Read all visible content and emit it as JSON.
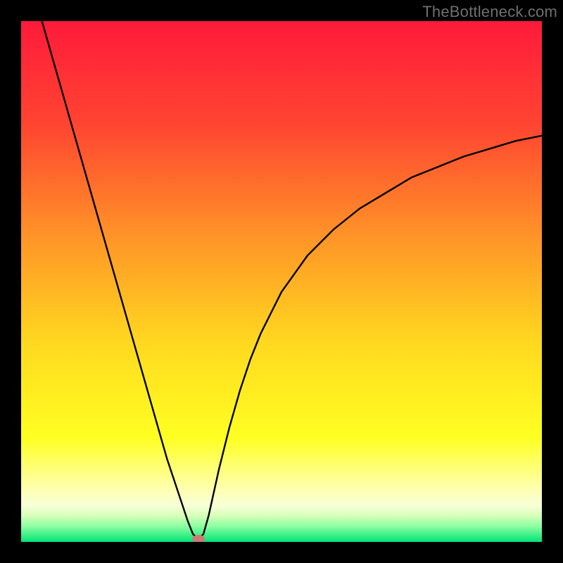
{
  "watermark": "TheBottleneck.com",
  "chart_data": {
    "type": "line",
    "title": "",
    "xlabel": "",
    "ylabel": "",
    "xlim": [
      0,
      100
    ],
    "ylim": [
      0,
      100
    ],
    "grid": false,
    "legend": false,
    "series": [
      {
        "name": "bottleneck-curve",
        "x": [
          4,
          6,
          8,
          10,
          12,
          14,
          16,
          18,
          20,
          22,
          24,
          26,
          28,
          30,
          32,
          33,
          34,
          35,
          36,
          38,
          40,
          42,
          44,
          46,
          48,
          50,
          55,
          60,
          65,
          70,
          75,
          80,
          85,
          90,
          95,
          100
        ],
        "y": [
          100,
          93,
          86,
          79,
          72,
          65,
          58,
          51,
          44,
          37,
          30,
          23,
          16,
          10,
          4,
          1.5,
          0.5,
          1.5,
          5,
          14,
          22,
          29,
          35,
          40,
          44,
          48,
          55,
          60,
          64,
          67,
          70,
          72,
          74,
          75.5,
          77,
          78
        ]
      }
    ],
    "marker": {
      "x": 34,
      "y": 0.5,
      "color": "#cc7b77"
    },
    "gradient_stops": [
      {
        "pct": 0,
        "color": "#ff1a3a"
      },
      {
        "pct": 20,
        "color": "#ff4531"
      },
      {
        "pct": 42,
        "color": "#ff9627"
      },
      {
        "pct": 62,
        "color": "#ffd91f"
      },
      {
        "pct": 80,
        "color": "#ffff22"
      },
      {
        "pct": 90,
        "color": "#feffb2"
      },
      {
        "pct": 93,
        "color": "#f7ffd7"
      },
      {
        "pct": 95,
        "color": "#d6ffb8"
      },
      {
        "pct": 97,
        "color": "#8cffa1"
      },
      {
        "pct": 100,
        "color": "#00e576"
      }
    ]
  }
}
